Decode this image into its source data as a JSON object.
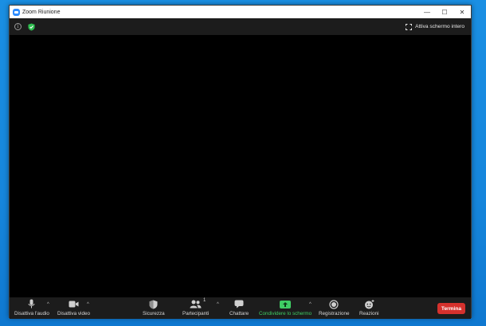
{
  "window": {
    "title": "Zoom Riunione"
  },
  "titlebar": {
    "minimize": "—",
    "maximize": "☐",
    "close": "✕"
  },
  "topbar": {
    "fullscreen_label": "Attiva schermo intero",
    "info_glyph": "i"
  },
  "toolbar": {
    "audio_label": "Disattiva l'audio",
    "video_label": "Disattiva video",
    "security_label": "Sicurezza",
    "participants_label": "Partecipanti",
    "participants_count": "1",
    "chat_label": "Chattare",
    "share_label": "Condividere lo schermo",
    "record_label": "Registrazione",
    "reactions_label": "Reazioni",
    "end_label": "Termina",
    "caret": "^"
  },
  "colors": {
    "accent_green": "#3fce64",
    "end_red": "#d5312d",
    "zoom_blue": "#2d8cff",
    "desktop_blue": "#1686dc"
  },
  "icons": [
    "info-icon",
    "shield-icon",
    "fullscreen-icon",
    "microphone-icon",
    "video-camera-icon",
    "security-shield-icon",
    "participants-icon",
    "chat-icon",
    "share-screen-icon",
    "record-icon",
    "reactions-icon"
  ]
}
